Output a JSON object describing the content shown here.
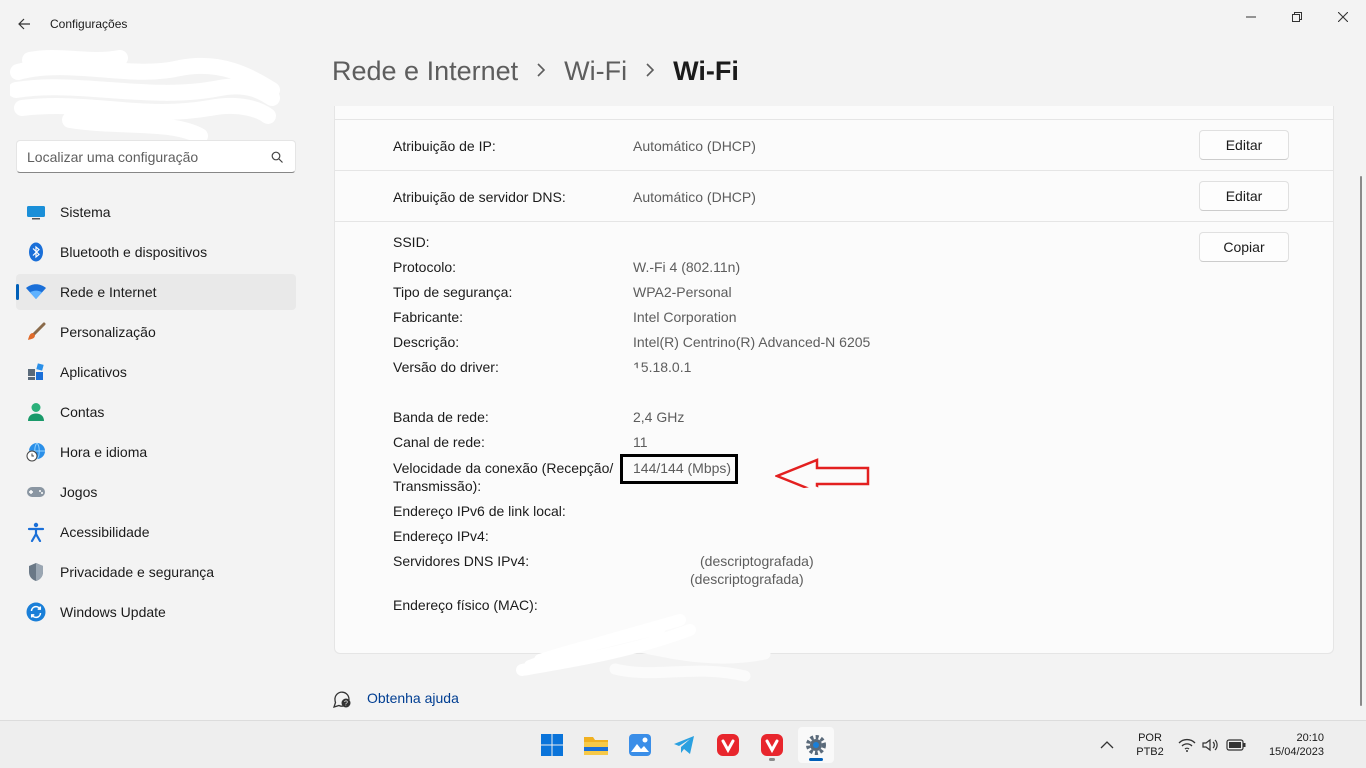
{
  "window": {
    "title": "Configurações"
  },
  "search": {
    "placeholder": "Localizar uma configuração"
  },
  "sidebar": {
    "items": [
      {
        "label": "Sistema",
        "icon": "system-icon"
      },
      {
        "label": "Bluetooth e dispositivos",
        "icon": "bluetooth-icon"
      },
      {
        "label": "Rede e Internet",
        "icon": "wifi-icon",
        "active": true
      },
      {
        "label": "Personalização",
        "icon": "brush-icon"
      },
      {
        "label": "Aplicativos",
        "icon": "apps-icon"
      },
      {
        "label": "Contas",
        "icon": "person-icon"
      },
      {
        "label": "Hora e idioma",
        "icon": "globe-clock-icon"
      },
      {
        "label": "Jogos",
        "icon": "gamepad-icon"
      },
      {
        "label": "Acessibilidade",
        "icon": "accessibility-icon"
      },
      {
        "label": "Privacidade e segurança",
        "icon": "shield-icon"
      },
      {
        "label": "Windows Update",
        "icon": "update-icon"
      }
    ]
  },
  "breadcrumb": {
    "items": [
      "Rede e Internet",
      "Wi-Fi"
    ],
    "current": "Wi-Fi"
  },
  "settings": {
    "ip_assignment": {
      "label": "Atribuição de IP:",
      "value": "Automático (DHCP)",
      "button": "Editar"
    },
    "dns_assignment": {
      "label": "Atribuição de servidor DNS:",
      "value": "Automático (DHCP)",
      "button": "Editar"
    },
    "copy_button": "Copiar"
  },
  "properties": {
    "ssid": {
      "label": "SSID:",
      "value": ""
    },
    "protocol": {
      "label": "Protocolo:",
      "value": "W.-Fi 4 (802.11n)"
    },
    "security": {
      "label": "Tipo de segurança:",
      "value": "WPA2-Personal"
    },
    "manufacturer": {
      "label": "Fabricante:",
      "value": "Intel Corporation"
    },
    "description": {
      "label": "Descrição:",
      "value": "Intel(R) Centrino(R) Advanced-N 6205"
    },
    "driver": {
      "label": "Versão do driver:",
      "value": "15.18.0.1"
    },
    "band": {
      "label": "Banda de rede:",
      "value": "2,4 GHz"
    },
    "channel": {
      "label": "Canal de rede:",
      "value": "11"
    },
    "speed": {
      "label_line1": "Velocidade da conexão (Recepção/",
      "label_line2": "Transmissão):",
      "value": "144/144 (Mbps)"
    },
    "ipv6": {
      "label": "Endereço IPv6 de link local:",
      "value": ""
    },
    "ipv4": {
      "label": "Endereço IPv4:",
      "value": ""
    },
    "dns_ipv4": {
      "label": "Servidores DNS IPv4:",
      "value_line1": "(descriptografada)",
      "value_line2": "(descriptografada)"
    },
    "mac": {
      "label": "Endereço físico (MAC):",
      "value": ""
    }
  },
  "help": {
    "link": "Obtenha ajuda"
  },
  "taskbar": {
    "apps": [
      "windows-start-icon",
      "file-explorer-icon",
      "photos-icon",
      "telegram-icon",
      "vivaldi-icon",
      "vivaldi-icon",
      "settings-icon"
    ],
    "lang_line1": "POR",
    "lang_line2": "PTB2",
    "time": "20:10",
    "date": "15/04/2023"
  },
  "colors": {
    "accent": "#005fb8",
    "annotation_red": "#e32020"
  }
}
